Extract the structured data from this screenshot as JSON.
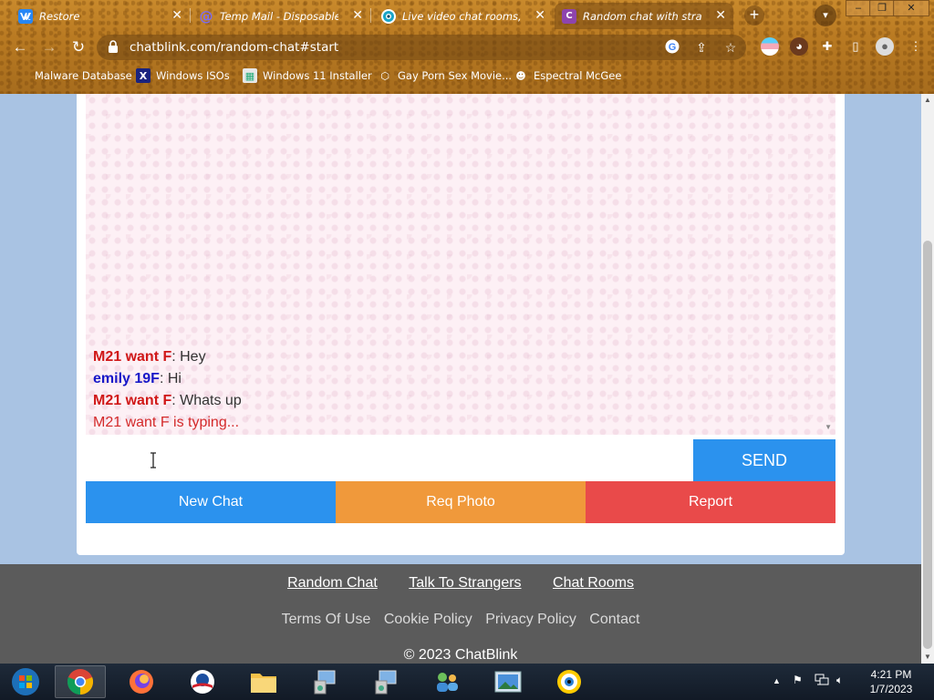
{
  "browser": {
    "tabs": [
      {
        "title": "Restore",
        "favicon": "vk-icon",
        "color": "#2787f5"
      },
      {
        "title": "Temp Mail - Disposable Te",
        "favicon": "at-icon",
        "color": "#6b5bd6"
      },
      {
        "title": "Live video chat rooms, sim",
        "favicon": "camera-icon",
        "color": "#1aa5c8"
      },
      {
        "title": "Random chat with strange",
        "favicon": "chatblink-c-icon",
        "color": "#8e44ad",
        "active": true
      }
    ],
    "url": "chatblink.com/random-chat#start",
    "bookmarks": [
      {
        "label": "Malware Database"
      },
      {
        "label": "Windows ISOs"
      },
      {
        "label": "Windows 11 Installer"
      },
      {
        "label": "Gay Porn Sex Movie..."
      },
      {
        "label": "Espectral McGee"
      }
    ]
  },
  "chat": {
    "messages": [
      {
        "sender": "M21 want F",
        "text": ": Hey",
        "color": "red"
      },
      {
        "sender": "emily 19F",
        "text": ": Hi",
        "color": "blue"
      },
      {
        "sender": "M21 want F",
        "text": ": Whats up",
        "color": "red"
      }
    ],
    "typing": "M21 want F is typing...",
    "input_value": "",
    "send_label": "SEND",
    "new_chat_label": "New Chat",
    "req_photo_label": "Req Photo",
    "report_label": "Report"
  },
  "footer": {
    "links": [
      "Random Chat",
      "Talk To Strangers",
      "Chat Rooms"
    ],
    "policy_links": [
      "Terms Of Use",
      "Cookie Policy",
      "Privacy Policy",
      "Contact"
    ],
    "copyright": "© 2023 ChatBlink"
  },
  "taskbar": {
    "time": "4:21 PM",
    "date": "1/7/2023"
  },
  "colors": {
    "send": "#2b92ee",
    "new_chat": "#2b92ee",
    "req_photo": "#f0993b",
    "report": "#e94a4a",
    "sender_red": "#d01717",
    "sender_blue": "#1818c8"
  }
}
